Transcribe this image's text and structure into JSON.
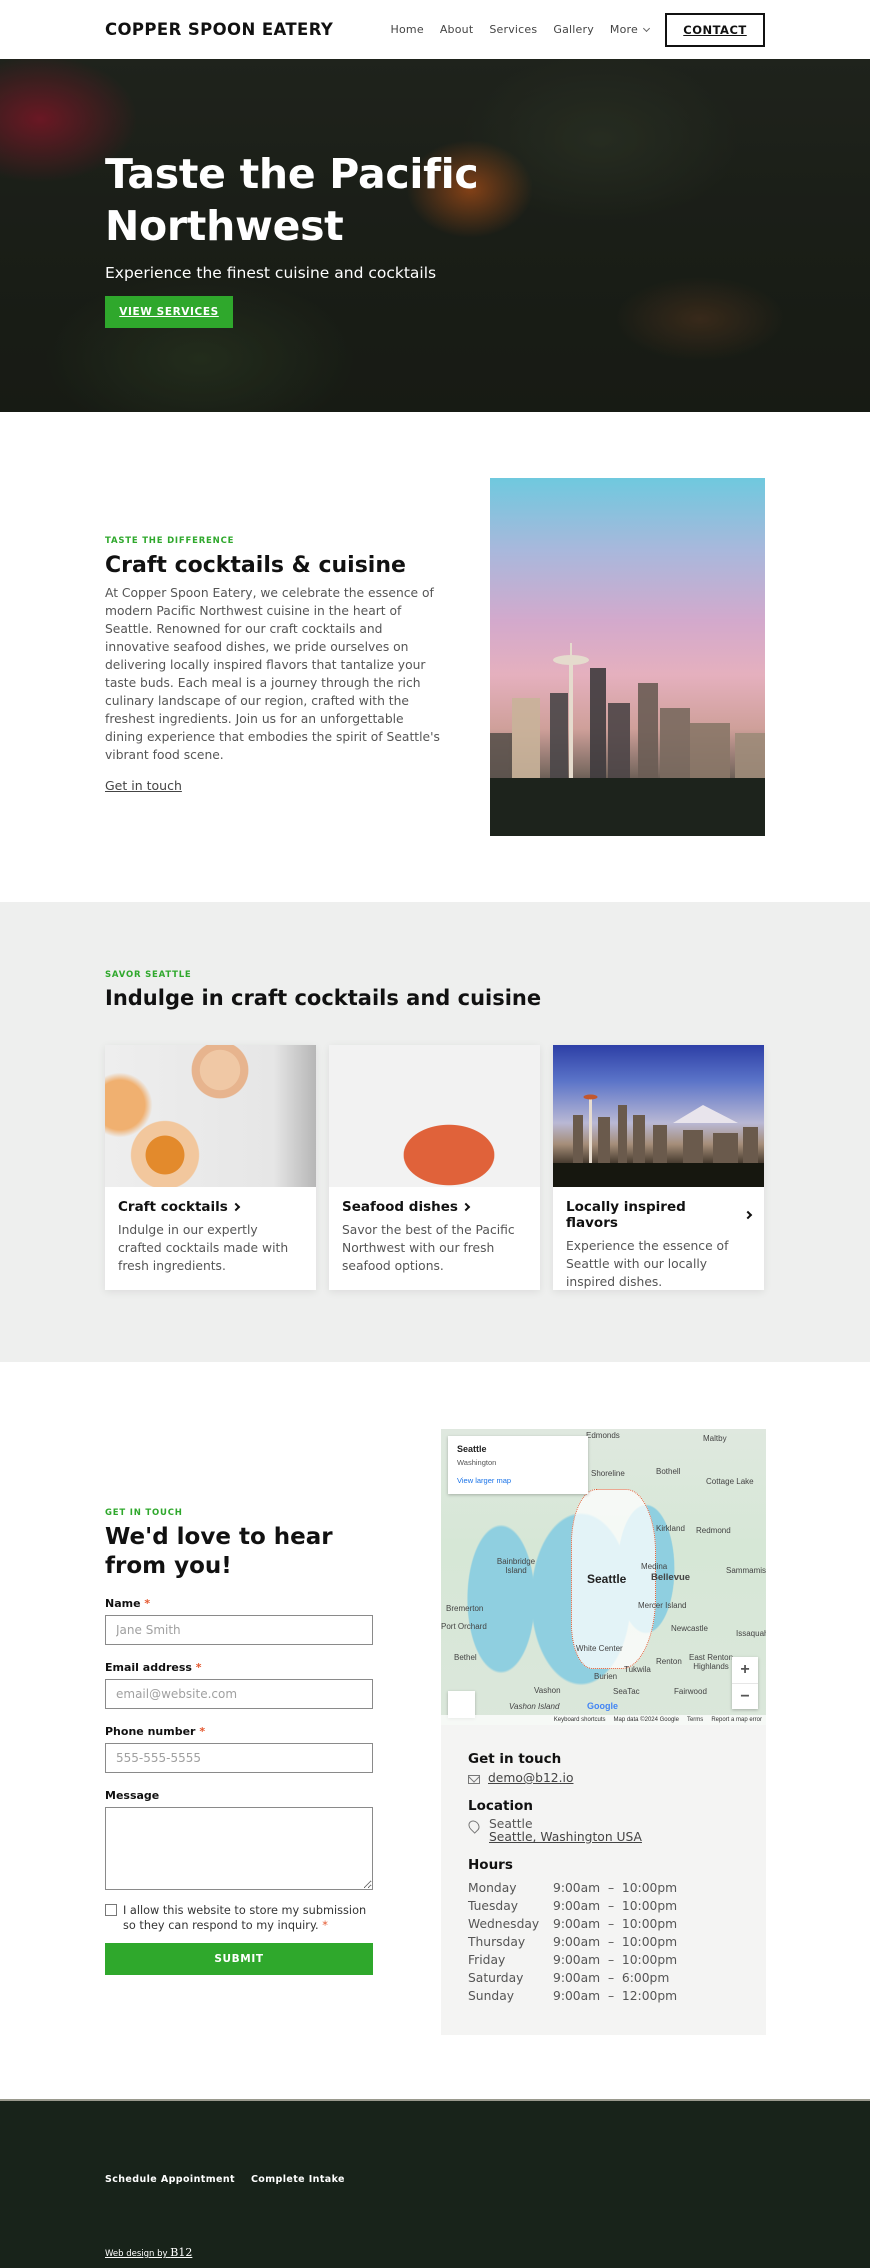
{
  "nav": {
    "brand": "COPPER SPOON EATERY",
    "links": [
      "Home",
      "About",
      "Services",
      "Gallery",
      "More"
    ],
    "contact_label": "CONTACT"
  },
  "hero": {
    "title": "Taste the Pacific Northwest",
    "subtitle": "Experience the finest cuisine and cocktails",
    "button_label": "VIEW SERVICES"
  },
  "about": {
    "eyebrow": "TASTE THE DIFFERENCE",
    "title": "Craft cocktails & cuisine",
    "body": "At Copper Spoon Eatery, we celebrate the essence of modern Pacific Northwest cuisine in the heart of Seattle. Renowned for our craft cocktails and innovative seafood dishes, we pride ourselves on delivering locally inspired flavors that tantalize your taste buds. Each meal is a journey through the rich culinary landscape of our region, crafted with the freshest ingredients. Join us for an unforgettable dining experience that embodies the spirit of Seattle's vibrant food scene.",
    "link_label": "Get in touch"
  },
  "services": {
    "eyebrow": "SAVOR SEATTLE",
    "title": "Indulge in craft cocktails and cuisine",
    "cards": [
      {
        "title": "Craft cocktails",
        "text": "Indulge in our expertly crafted cocktails made with fresh ingredients."
      },
      {
        "title": "Seafood dishes",
        "text": "Savor the best of the Pacific Northwest with our fresh seafood options."
      },
      {
        "title": "Locally inspired flavors",
        "text": "Experience the essence of Seattle with our locally inspired dishes."
      }
    ]
  },
  "contact": {
    "eyebrow": "GET IN TOUCH",
    "title": "We'd love to hear from you!",
    "required_mark": "*",
    "fields": {
      "name": {
        "label": "Name",
        "placeholder": "Jane Smith"
      },
      "email": {
        "label": "Email address",
        "placeholder": "email@website.com"
      },
      "phone": {
        "label": "Phone number",
        "placeholder": "555-555-5555"
      },
      "message": {
        "label": "Message",
        "placeholder": ""
      }
    },
    "consent": "I allow this website to store my submission so they can respond to my inquiry.",
    "submit_label": "SUBMIT"
  },
  "map": {
    "card_title": "Seattle",
    "card_subtitle": "Washington",
    "card_link": "View larger map",
    "labels": [
      "Edmonds",
      "Maltby",
      "Bothell",
      "Cottage Lake",
      "Shoreline",
      "Kirkland",
      "Redmond",
      "Bainbridge Island",
      "Seattle",
      "Medina",
      "Bellevue",
      "Sammamish",
      "Bremerton",
      "Port Orchard",
      "Mercer Island",
      "Newcastle",
      "Issaquah",
      "White Center",
      "Renton",
      "East Renton Highlands",
      "Bethel",
      "Burien",
      "Tukwila",
      "Vashon",
      "SeaTac",
      "Fairwood",
      "Vashon Island"
    ],
    "zoom_in": "+",
    "zoom_out": "−",
    "google": "Google",
    "footer": [
      "Keyboard shortcuts",
      "Map data ©2024 Google",
      "Terms",
      "Report a map error"
    ]
  },
  "info": {
    "touch_heading": "Get in touch",
    "email": "demo@b12.io",
    "location_heading": "Location",
    "city": "Seattle",
    "address": "Seattle, Washington USA",
    "hours_heading": "Hours",
    "hours": [
      {
        "day": "Monday",
        "time": "9:00am  –  10:00pm"
      },
      {
        "day": "Tuesday",
        "time": "9:00am  –  10:00pm"
      },
      {
        "day": "Wednesday",
        "time": "9:00am  –  10:00pm"
      },
      {
        "day": "Thursday",
        "time": "9:00am  –  10:00pm"
      },
      {
        "day": "Friday",
        "time": "9:00am  –  10:00pm"
      },
      {
        "day": "Saturday",
        "time": "9:00am  –  6:00pm"
      },
      {
        "day": "Sunday",
        "time": "9:00am  –  12:00pm"
      }
    ]
  },
  "footer": {
    "links": [
      "Schedule Appointment",
      "Complete Intake"
    ],
    "credit_prefix": "Web design by",
    "credit_brand": "B12"
  },
  "colors": {
    "accent": "#2fa82c",
    "required": "#e4572e",
    "footer_bg": "#18231a",
    "section_gray": "#eeefee"
  }
}
